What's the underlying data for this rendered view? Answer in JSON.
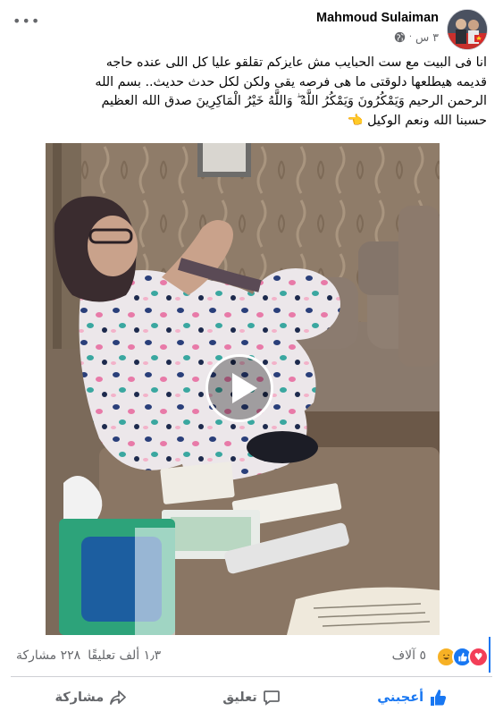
{
  "post": {
    "author": "Mahmoud Sulaiman",
    "time": "٣ س",
    "separator": "·",
    "privacy_icon": "globe-icon",
    "more_icon": "more-dots-icon",
    "caption_lines": [
      "انا فى البيت مع ست الحبايب مش عايزكم تقلقو عليا كل اللى عنده حاجه",
      "قديمه هيطلعها دلوقتى ما هى فرصه يقى ولكن لكل حدث حديث.. بسم الله",
      "الرحمن الرحيم وَيَمْكُرُونَ وَيَمْكُرُ اللَّهُ ۖ وَاللَّهُ خَيْرُ الْمَاكِرِينَ صدق الله العظيم",
      "حسبنا الله ونعم الوكيل 👈"
    ]
  },
  "video": {
    "play_icon": "play-icon"
  },
  "stats": {
    "reactions": [
      "love",
      "like",
      "haha"
    ],
    "reaction_count": "٥ آلاف",
    "comments": "١٫٣ ألف تعليقًا",
    "shares": "٢٢٨ مشاركة"
  },
  "actions": {
    "like": "أعجبني",
    "comment": "تعليق",
    "share": "مشاركة"
  },
  "colors": {
    "accent": "#1877f2",
    "text": "#050505",
    "muted": "#65676b",
    "love": "#f33e58",
    "haha": "#f7b125"
  }
}
